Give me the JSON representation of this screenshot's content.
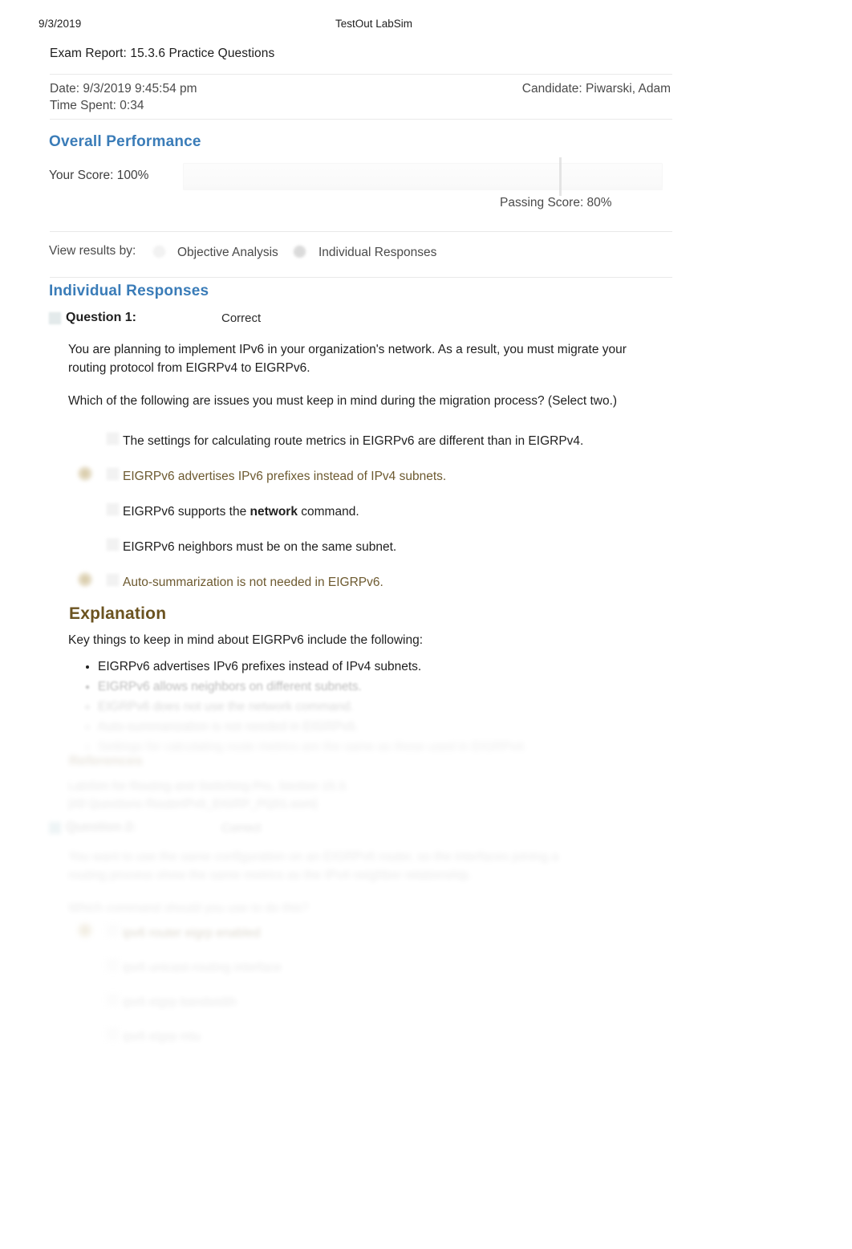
{
  "print_header": {
    "date": "9/3/2019",
    "app_title": "TestOut LabSim"
  },
  "report": {
    "title": "Exam Report: 15.3.6 Practice Questions",
    "date_line": "Date: 9/3/2019 9:45:54 pm",
    "time_spent_line": "Time Spent: 0:34",
    "candidate_line": "Candidate: Piwarski, Adam"
  },
  "overall": {
    "heading": "Overall Performance",
    "your_score_label": "Your Score: 100%",
    "passing_score_label": "Passing Score: 80%",
    "score_percent": 100,
    "passing_percent": 80
  },
  "view_results": {
    "label": "View results by:",
    "options": [
      {
        "label": "Objective Analysis",
        "selected": false
      },
      {
        "label": "Individual Responses",
        "selected": true
      }
    ]
  },
  "individual_responses": {
    "heading": "Individual Responses"
  },
  "question1": {
    "number_label": "Question 1:",
    "status": "Correct",
    "stem_1": "You are planning to implement IPv6 in your organization's network. As a result, you must migrate your routing protocol from EIGRPv4 to EIGRPv6.",
    "stem_2": "Which of the following are issues you must keep in mind during the migration process? (Select two.)",
    "options": [
      {
        "text": "The settings for calculating route metrics in EIGRPv6 are different than in EIGRPv4.",
        "correct": false
      },
      {
        "text": "EIGRPv6 advertises IPv6 prefixes instead of IPv4 subnets.",
        "correct": true
      },
      {
        "text_before": "EIGRPv6 supports the ",
        "bold": "network",
        "text_after": " command.",
        "correct": false
      },
      {
        "text": "EIGRPv6 neighbors must be on the same subnet.",
        "correct": false
      },
      {
        "text": "Auto-summarization is not needed in EIGRPv6.",
        "correct": true
      }
    ],
    "explanation": {
      "heading": "Explanation",
      "intro": "Key things to keep in mind about EIGRPv6 include the following:",
      "bullets": [
        "EIGRPv6 advertises IPv6 prefixes instead of IPv4 subnets.",
        "EIGRPv6 allows neighbors on different subnets.",
        "EIGRPv6 does not use the network command.",
        "Auto-summarization is not needed in EIGRPv6.",
        "Settings for calculating route metrics are the same as those used in EIGRPv4."
      ]
    },
    "references": {
      "heading": "References",
      "lines": [
        "LabSim for Routing and Switching Pro, Section 15.3.",
        "[All Questions RouterIPv6_EIGRP_PQ01.exm]"
      ]
    }
  },
  "question2": {
    "number_label": "Question 2:",
    "status": "Correct",
    "stem_1": "You want to use the same configuration on an EIGRPv6 router, so the interfaces joining a routing process show the same metrics as the IPv4 neighbor relationship.",
    "stem_2": "Which command should you use to do this?",
    "options": [
      {
        "text": "ipv6 router eigrp enabled",
        "correct": true
      },
      {
        "text": "ipv6 unicast-routing interface",
        "correct": false
      },
      {
        "text": "ipv6 eigrp bandwidth",
        "correct": false
      },
      {
        "text": "ipv6 eigrp mtu",
        "correct": false
      }
    ]
  },
  "colors": {
    "section_heading_blue": "#3a7cb8",
    "correct_answer_brown": "#6d5a30",
    "explanation_heading_brown": "#6b5320",
    "body_text": "#1f1f1f",
    "muted_text": "#4a4a4a"
  }
}
